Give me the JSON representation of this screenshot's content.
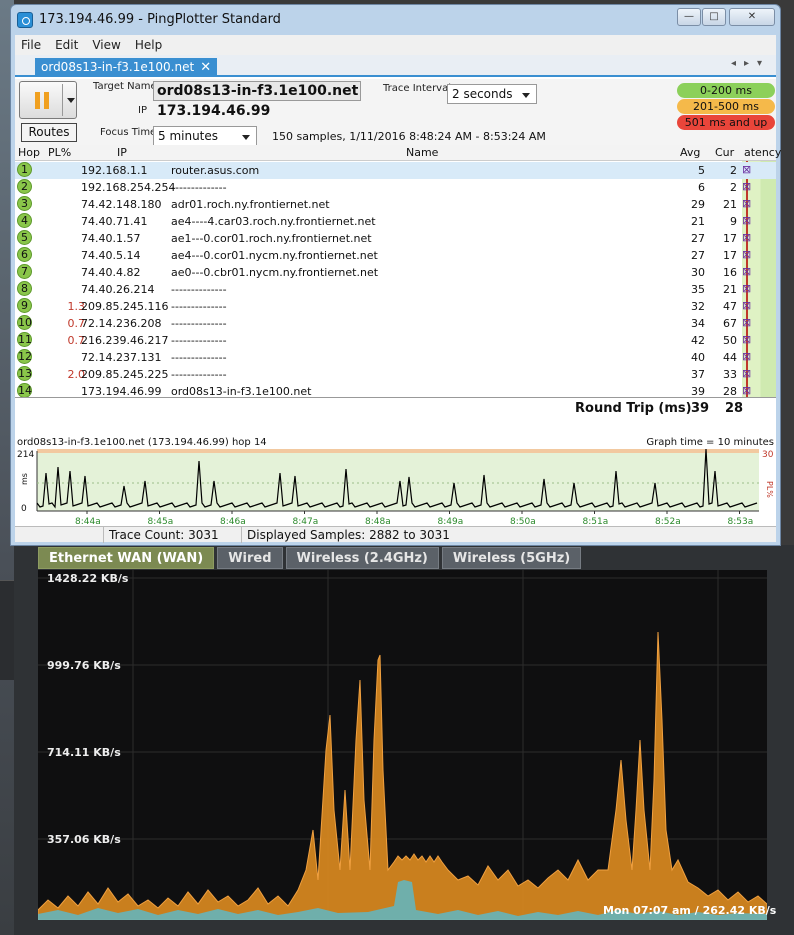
{
  "window": {
    "title": "173.194.46.99 - PingPlotter Standard",
    "min": "—",
    "max": "□",
    "close": "✕"
  },
  "menu": [
    "File",
    "Edit",
    "View",
    "Help"
  ],
  "doc_tab": {
    "label": "ord08s13-in-f3.1e100.net",
    "close": "✕",
    "nav": "◂▸▾"
  },
  "toolbar": {
    "target_label": "Target Name",
    "target_value": "ord08s13-in-f3.1e100.net",
    "ip_label": "IP",
    "ip_value": "173.194.46.99",
    "focus_label": "Focus Time",
    "focus_value": "5 minutes",
    "interval_label": "Trace Interval",
    "interval_value": "2 seconds",
    "routes_label": "Routes",
    "samples_text": "150 samples, 1/11/2016 8:48:24 AM - 8:53:24 AM"
  },
  "legend": [
    {
      "label": "0-200 ms",
      "color": "#8cd05a"
    },
    {
      "label": "201-500 ms",
      "color": "#f5b94a"
    },
    {
      "label": "501 ms and up",
      "color": "#e9453a"
    }
  ],
  "table": {
    "headers": {
      "hop": "Hop",
      "pl": "PL%",
      "ip": "IP",
      "name": "Name",
      "avg": "Avg",
      "cur": "Cur",
      "latency": "atency"
    },
    "rows": [
      {
        "hop": "1",
        "pl": "",
        "ip": "192.168.1.1",
        "name": "router.asus.com",
        "avg": "5",
        "cur": "2"
      },
      {
        "hop": "2",
        "pl": "",
        "ip": "192.168.254.254",
        "name": "--------------",
        "avg": "6",
        "cur": "2"
      },
      {
        "hop": "3",
        "pl": "",
        "ip": "74.42.148.180",
        "name": "adr01.roch.ny.frontiernet.net",
        "avg": "29",
        "cur": "21"
      },
      {
        "hop": "4",
        "pl": "",
        "ip": "74.40.71.41",
        "name": "ae4----4.car03.roch.ny.frontiernet.net",
        "avg": "21",
        "cur": "9"
      },
      {
        "hop": "5",
        "pl": "",
        "ip": "74.40.1.57",
        "name": "ae1---0.cor01.roch.ny.frontiernet.net",
        "avg": "27",
        "cur": "17"
      },
      {
        "hop": "6",
        "pl": "",
        "ip": "74.40.5.14",
        "name": "ae4---0.cor01.nycm.ny.frontiernet.net",
        "avg": "27",
        "cur": "17"
      },
      {
        "hop": "7",
        "pl": "",
        "ip": "74.40.4.82",
        "name": "ae0---0.cbr01.nycm.ny.frontiernet.net",
        "avg": "30",
        "cur": "16"
      },
      {
        "hop": "8",
        "pl": "",
        "ip": "74.40.26.214",
        "name": "--------------",
        "avg": "35",
        "cur": "21"
      },
      {
        "hop": "9",
        "pl": "1.3",
        "ip": "209.85.245.116",
        "name": "--------------",
        "avg": "32",
        "cur": "47"
      },
      {
        "hop": "10",
        "pl": "0.7",
        "ip": "72.14.236.208",
        "name": "--------------",
        "avg": "34",
        "cur": "67"
      },
      {
        "hop": "11",
        "pl": "0.7",
        "ip": "216.239.46.217",
        "name": "--------------",
        "avg": "42",
        "cur": "50"
      },
      {
        "hop": "12",
        "pl": "",
        "ip": "72.14.237.131",
        "name": "--------------",
        "avg": "40",
        "cur": "44"
      },
      {
        "hop": "13",
        "pl": "2.0",
        "ip": "209.85.245.225",
        "name": "--------------",
        "avg": "37",
        "cur": "33"
      },
      {
        "hop": "14",
        "pl": "",
        "ip": "173.194.46.99",
        "name": "ord08s13-in-f3.1e100.net",
        "avg": "39",
        "cur": "28"
      }
    ],
    "round_trip_label": "Round Trip (ms)",
    "round_trip_avg": "39",
    "round_trip_cur": "28"
  },
  "timeline": {
    "title": "ord08s13-in-f3.1e100.net (173.194.46.99) hop 14",
    "graph_time": "Graph time = 10 minutes",
    "y_max": "214",
    "y_min": "0",
    "y_unit": "ms",
    "pl_max": "30",
    "pl_unit": "PL%",
    "x_ticks": [
      "8:44a",
      "8:45a",
      "8:46a",
      "8:47a",
      "8:48a",
      "8:49a",
      "8:50a",
      "8:51a",
      "8:52a",
      "8:53a"
    ]
  },
  "status": {
    "trace_count": "Trace Count: 3031",
    "displayed": "Displayed Samples: 2882 to 3031"
  },
  "wan": {
    "tabs": [
      "Ethernet WAN (WAN)",
      "Wired",
      "Wireless (2.4GHz)",
      "Wireless (5GHz)"
    ],
    "y_labels": [
      "1428.22 KB/s",
      "999.76 KB/s",
      "714.11 KB/s",
      "357.06 KB/s"
    ],
    "readout": "Mon 07:07 am / 262.42 KB/s",
    "colors": {
      "rx": "#e08a1e",
      "tx": "#5fb7c4"
    }
  }
}
